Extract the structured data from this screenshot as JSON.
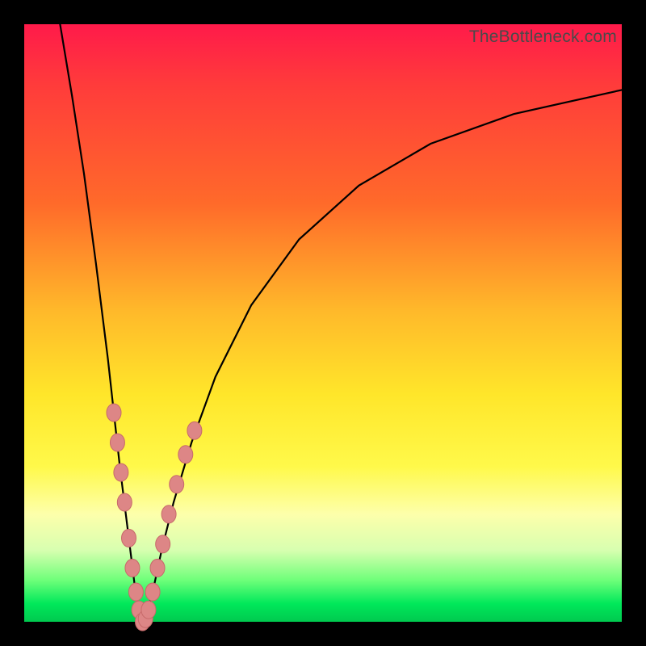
{
  "watermark": "TheBottleneck.com",
  "chart_data": {
    "type": "line",
    "title": "",
    "xlabel": "",
    "ylabel": "",
    "xlim": [
      0,
      100
    ],
    "ylim": [
      0,
      100
    ],
    "grid": false,
    "series": [
      {
        "name": "left-branch",
        "x": [
          6,
          8,
          10,
          12,
          14,
          16,
          17.5,
          18.5,
          19.2,
          19.8
        ],
        "values": [
          100,
          88,
          75,
          60,
          44,
          26,
          14,
          6,
          1.5,
          0
        ]
      },
      {
        "name": "right-branch",
        "x": [
          19.8,
          20.5,
          21.5,
          23,
          25,
          28,
          32,
          38,
          46,
          56,
          68,
          82,
          100
        ],
        "values": [
          0,
          1.5,
          5,
          12,
          20,
          30,
          41,
          53,
          64,
          73,
          80,
          85,
          89
        ]
      }
    ],
    "markers": {
      "name": "highlight-points",
      "color": "#d97a7a",
      "points": [
        {
          "x": 15.0,
          "y": 35
        },
        {
          "x": 15.6,
          "y": 30
        },
        {
          "x": 16.2,
          "y": 25
        },
        {
          "x": 16.8,
          "y": 20
        },
        {
          "x": 17.5,
          "y": 14
        },
        {
          "x": 18.1,
          "y": 9
        },
        {
          "x": 18.7,
          "y": 5
        },
        {
          "x": 19.2,
          "y": 2
        },
        {
          "x": 19.8,
          "y": 0
        },
        {
          "x": 20.3,
          "y": 0.5
        },
        {
          "x": 20.8,
          "y": 2
        },
        {
          "x": 21.5,
          "y": 5
        },
        {
          "x": 22.3,
          "y": 9
        },
        {
          "x": 23.2,
          "y": 13
        },
        {
          "x": 24.2,
          "y": 18
        },
        {
          "x": 25.5,
          "y": 23
        },
        {
          "x": 27.0,
          "y": 28
        },
        {
          "x": 28.5,
          "y": 32
        }
      ]
    }
  },
  "colors": {
    "curve": "#000000",
    "marker_fill": "#dd8686",
    "marker_stroke": "#c76a6a"
  }
}
